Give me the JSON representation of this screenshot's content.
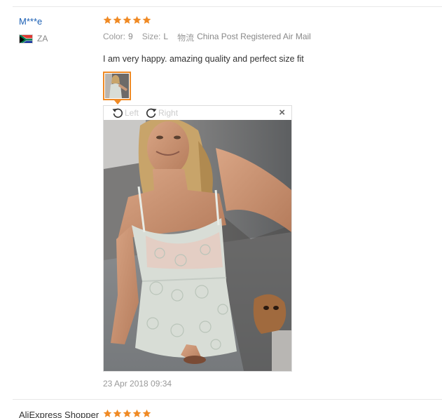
{
  "reviews": [
    {
      "username": "M***e",
      "country": "ZA",
      "rating": 5,
      "attributes": {
        "color_label": "Color:",
        "color_value": "9",
        "size_label": "Size:",
        "size_value": "L",
        "shipping_label": "物流",
        "shipping_value": "China Post Registered Air Mail"
      },
      "text": "I am very happy. amazing quality and perfect size fit",
      "viewer": {
        "rotate_left_label": "Left",
        "rotate_right_label": "Right",
        "close_symbol": "×"
      },
      "date": "23 Apr 2018 09:34"
    },
    {
      "username": "AliExpress Shopper",
      "rating": 5
    }
  ],
  "colors": {
    "accent": "#f08a24",
    "username": "#1a5fb4",
    "star": "#f08a24"
  }
}
